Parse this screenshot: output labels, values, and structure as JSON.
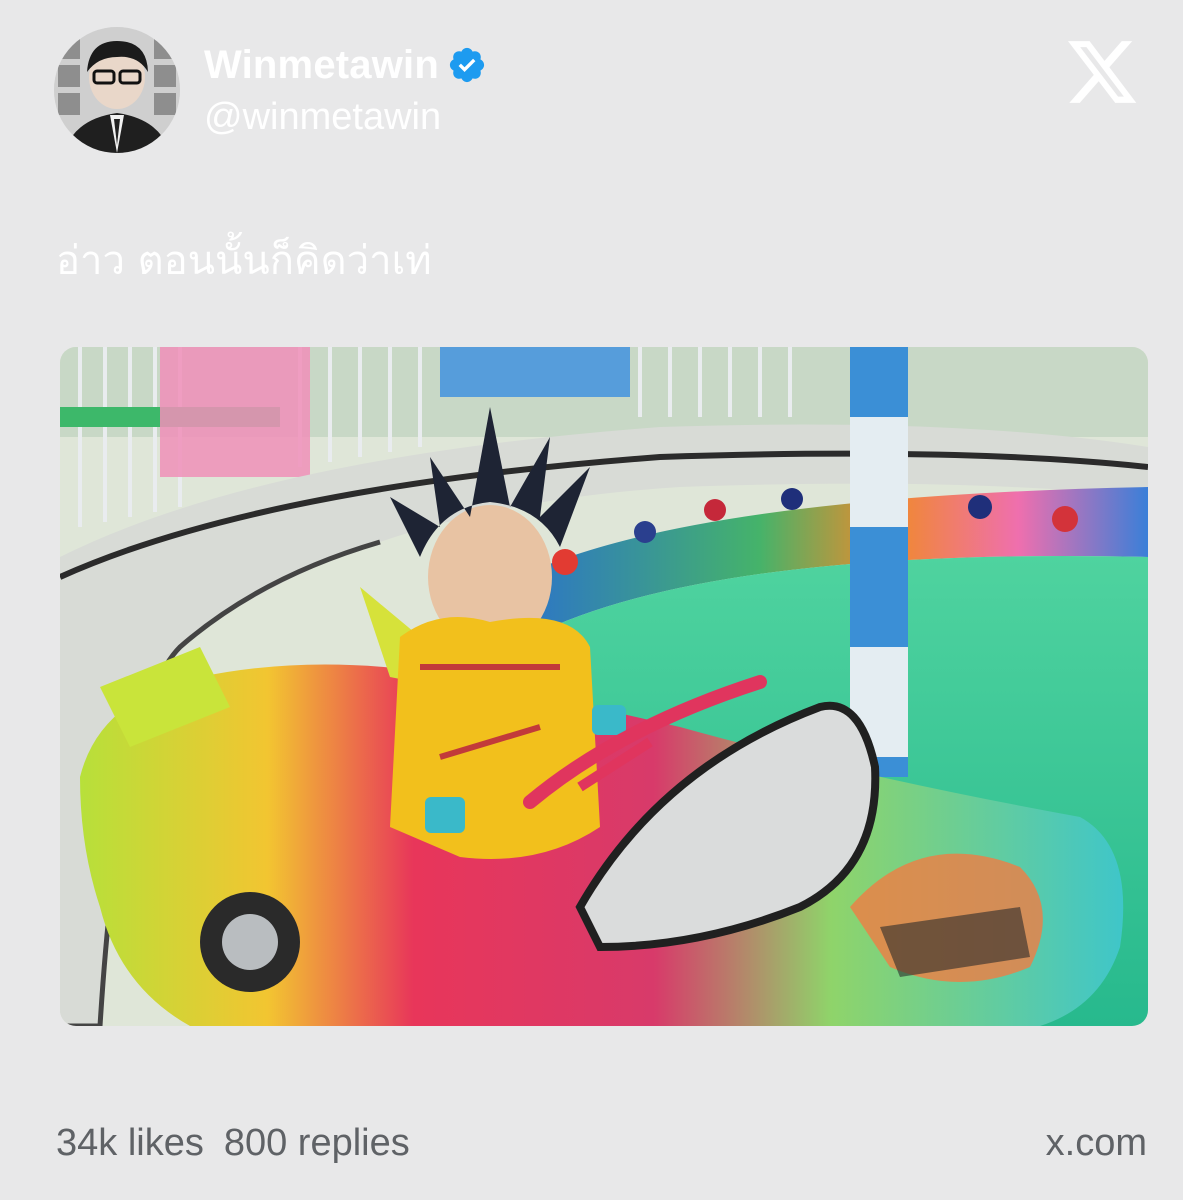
{
  "post": {
    "display_name": "Winmetawin",
    "handle": "@winmetawin",
    "verified": true,
    "verified_icon": "verified-badge-icon",
    "text": "อ่าว ตอนนั้นก็คิดว่าเท่"
  },
  "brand": {
    "logo_icon": "x-logo-icon"
  },
  "footer": {
    "likes": "34k likes",
    "replies": "800 replies",
    "domain": "x.com"
  },
  "colors": {
    "background": "#e8e8e9",
    "verified_blue": "#1d9bf0",
    "footer_text": "#5f6266"
  }
}
